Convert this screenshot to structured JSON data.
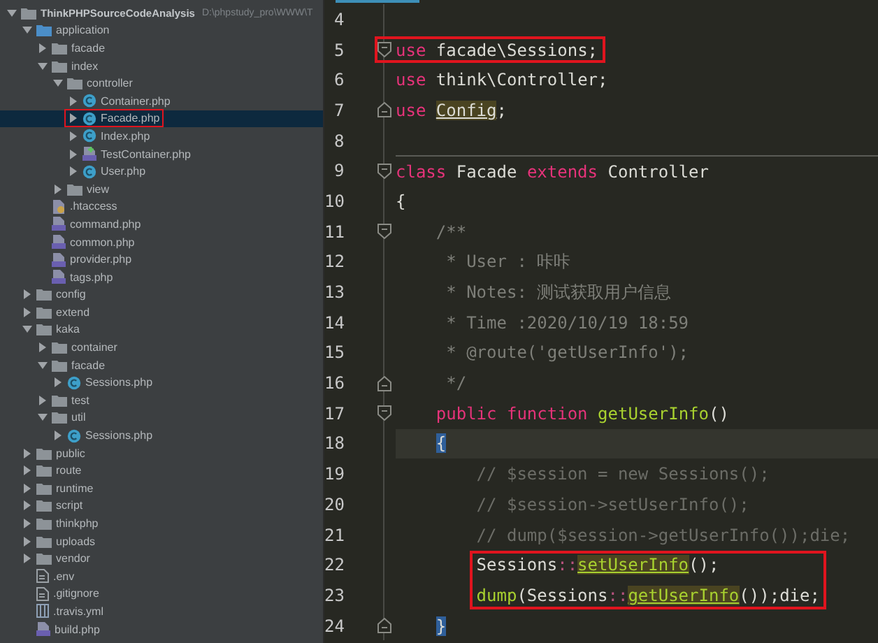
{
  "project_tree": {
    "label": "ThinkPHPSourceCodeAnalysis",
    "path": "D:\\phpstudy_pro\\WWW\\T",
    "kind": "folder",
    "expanded": true,
    "selected": false,
    "boxed": false,
    "children": [
      {
        "label": "application",
        "kind": "source",
        "expanded": true,
        "selected": false,
        "boxed": false,
        "children": [
          {
            "label": "facade",
            "kind": "folder",
            "expanded": false,
            "selected": false,
            "boxed": false
          },
          {
            "label": "index",
            "kind": "folder",
            "expanded": true,
            "selected": false,
            "boxed": false,
            "children": [
              {
                "label": "controller",
                "kind": "folder",
                "expanded": true,
                "selected": false,
                "boxed": false,
                "children": [
                  {
                    "label": "Container.php",
                    "kind": "class",
                    "expanded": false,
                    "selected": false,
                    "boxed": false
                  },
                  {
                    "label": "Facade.php",
                    "kind": "class",
                    "expanded": false,
                    "selected": true,
                    "boxed": true
                  },
                  {
                    "label": "Index.php",
                    "kind": "class",
                    "expanded": false,
                    "selected": false,
                    "boxed": false
                  },
                  {
                    "label": "TestContainer.php",
                    "kind": "test",
                    "expanded": false,
                    "selected": false,
                    "boxed": false
                  },
                  {
                    "label": "User.php",
                    "kind": "class",
                    "expanded": false,
                    "selected": false,
                    "boxed": false
                  }
                ]
              },
              {
                "label": "view",
                "kind": "folder",
                "expanded": false,
                "selected": false,
                "boxed": false
              }
            ]
          },
          {
            "label": ".htaccess",
            "kind": "config",
            "selected": false,
            "boxed": false
          },
          {
            "label": "command.php",
            "kind": "php",
            "selected": false,
            "boxed": false
          },
          {
            "label": "common.php",
            "kind": "php",
            "selected": false,
            "boxed": false
          },
          {
            "label": "provider.php",
            "kind": "php",
            "selected": false,
            "boxed": false
          },
          {
            "label": "tags.php",
            "kind": "php",
            "selected": false,
            "boxed": false
          }
        ]
      },
      {
        "label": "config",
        "kind": "folder",
        "expanded": false,
        "selected": false,
        "boxed": false
      },
      {
        "label": "extend",
        "kind": "folder",
        "expanded": false,
        "selected": false,
        "boxed": false
      },
      {
        "label": "kaka",
        "kind": "folder",
        "expanded": true,
        "selected": false,
        "boxed": false,
        "children": [
          {
            "label": "container",
            "kind": "folder",
            "expanded": false,
            "selected": false,
            "boxed": false
          },
          {
            "label": "facade",
            "kind": "folder",
            "expanded": true,
            "selected": false,
            "boxed": false,
            "children": [
              {
                "label": "Sessions.php",
                "kind": "class",
                "expanded": false,
                "selected": false,
                "boxed": false
              }
            ]
          },
          {
            "label": "test",
            "kind": "folder",
            "expanded": false,
            "selected": false,
            "boxed": false
          },
          {
            "label": "util",
            "kind": "folder",
            "expanded": true,
            "selected": false,
            "boxed": false,
            "children": [
              {
                "label": "Sessions.php",
                "kind": "class",
                "expanded": false,
                "selected": false,
                "boxed": false
              }
            ]
          }
        ]
      },
      {
        "label": "public",
        "kind": "folder",
        "expanded": false,
        "selected": false,
        "boxed": false
      },
      {
        "label": "route",
        "kind": "folder",
        "expanded": false,
        "selected": false,
        "boxed": false
      },
      {
        "label": "runtime",
        "kind": "folder",
        "expanded": false,
        "selected": false,
        "boxed": false
      },
      {
        "label": "script",
        "kind": "folder",
        "expanded": false,
        "selected": false,
        "boxed": false
      },
      {
        "label": "thinkphp",
        "kind": "folder",
        "expanded": false,
        "selected": false,
        "boxed": false
      },
      {
        "label": "uploads",
        "kind": "folder",
        "expanded": false,
        "selected": false,
        "boxed": false
      },
      {
        "label": "vendor",
        "kind": "folder",
        "expanded": false,
        "selected": false,
        "boxed": false
      },
      {
        "label": ".env",
        "kind": "text",
        "selected": false,
        "boxed": false
      },
      {
        "label": ".gitignore",
        "kind": "text",
        "selected": false,
        "boxed": false
      },
      {
        "label": ".travis.yml",
        "kind": "yml",
        "selected": false,
        "boxed": false
      },
      {
        "label": "build.php",
        "kind": "php",
        "selected": false,
        "boxed": false
      }
    ]
  },
  "code": {
    "lines": [
      {
        "number": "4",
        "fold_open": false,
        "fold_close": false,
        "current": false,
        "separator": false,
        "boxed": false
      },
      {
        "number": "5",
        "fold_open": true,
        "fold_close": false,
        "current": false,
        "separator": false,
        "boxed": true,
        "tokens": [
          {
            "kind": "keyword",
            "text": "use"
          },
          {
            "kind": "plain",
            "text": " facade\\Sessions;"
          }
        ]
      },
      {
        "number": "6",
        "fold_open": false,
        "fold_close": false,
        "current": false,
        "separator": false,
        "boxed": false,
        "tokens": [
          {
            "kind": "keyword",
            "text": "use"
          },
          {
            "kind": "plain",
            "text": " think\\Controller;"
          }
        ]
      },
      {
        "number": "7",
        "fold_open": false,
        "fold_close": true,
        "current": false,
        "separator": false,
        "boxed": false,
        "tokens": [
          {
            "kind": "keyword",
            "text": "use "
          },
          {
            "kind": "reference",
            "text": "Config"
          },
          {
            "kind": "plain",
            "text": ";"
          }
        ]
      },
      {
        "number": "8",
        "fold_open": false,
        "fold_close": false,
        "current": false,
        "separator": false,
        "boxed": false
      },
      {
        "number": "9",
        "fold_open": true,
        "fold_close": false,
        "current": false,
        "separator": true,
        "boxed": false,
        "tokens": [
          {
            "kind": "keyword",
            "text": "class"
          },
          {
            "kind": "plain",
            "text": " Facade "
          },
          {
            "kind": "keyword",
            "text": "extends"
          },
          {
            "kind": "plain",
            "text": " Controller"
          }
        ]
      },
      {
        "number": "10",
        "fold_open": false,
        "fold_close": false,
        "current": false,
        "separator": false,
        "boxed": false,
        "tokens": [
          {
            "kind": "plain",
            "text": "{"
          }
        ]
      },
      {
        "number": "11",
        "fold_open": true,
        "fold_close": false,
        "current": false,
        "separator": false,
        "boxed": false,
        "tokens": [
          {
            "kind": "doc",
            "text": "    /**"
          }
        ]
      },
      {
        "number": "12",
        "fold_open": false,
        "fold_close": false,
        "current": false,
        "separator": false,
        "boxed": false,
        "tokens": [
          {
            "kind": "doc",
            "text": "     * User : 咔咔"
          }
        ]
      },
      {
        "number": "13",
        "fold_open": false,
        "fold_close": false,
        "current": false,
        "separator": false,
        "boxed": false,
        "tokens": [
          {
            "kind": "doc",
            "text": "     * Notes: 测试获取用户信息"
          }
        ]
      },
      {
        "number": "14",
        "fold_open": false,
        "fold_close": false,
        "current": false,
        "separator": false,
        "boxed": false,
        "tokens": [
          {
            "kind": "doc",
            "text": "     * Time :2020/10/19 18:59"
          }
        ]
      },
      {
        "number": "15",
        "fold_open": false,
        "fold_close": false,
        "current": false,
        "separator": false,
        "boxed": false,
        "tokens": [
          {
            "kind": "doc",
            "text": "     * @route('getUserInfo');"
          }
        ]
      },
      {
        "number": "16",
        "fold_open": false,
        "fold_close": true,
        "current": false,
        "separator": false,
        "boxed": false,
        "tokens": [
          {
            "kind": "doc",
            "text": "     */"
          }
        ]
      },
      {
        "number": "17",
        "fold_open": true,
        "fold_close": false,
        "current": false,
        "separator": false,
        "boxed": false,
        "tokens": [
          {
            "kind": "keyword",
            "text": "    public function"
          },
          {
            "kind": "function",
            "text": " getUserInfo"
          },
          {
            "kind": "plain",
            "text": "()"
          }
        ]
      },
      {
        "number": "18",
        "fold_open": false,
        "fold_close": false,
        "current": true,
        "separator": false,
        "boxed": false,
        "tokens": [
          {
            "kind": "brace",
            "text": "    {"
          }
        ]
      },
      {
        "number": "19",
        "fold_open": false,
        "fold_close": false,
        "current": false,
        "separator": false,
        "boxed": false,
        "tokens": [
          {
            "kind": "comment",
            "text": "        // $session = new Sessions();"
          }
        ]
      },
      {
        "number": "20",
        "fold_open": false,
        "fold_close": false,
        "current": false,
        "separator": false,
        "boxed": false,
        "tokens": [
          {
            "kind": "comment",
            "text": "        // $session->setUserInfo();"
          }
        ]
      },
      {
        "number": "21",
        "fold_open": false,
        "fold_close": false,
        "current": false,
        "separator": false,
        "boxed": false,
        "tokens": [
          {
            "kind": "comment",
            "text": "        // dump($session->getUserInfo());die;"
          }
        ]
      },
      {
        "number": "22",
        "fold_open": false,
        "fold_close": false,
        "current": false,
        "separator": false,
        "boxed": true,
        "tokens": [
          {
            "kind": "plain",
            "text": "        Sessions"
          },
          {
            "kind": "operator",
            "text": "::"
          },
          {
            "kind": "call",
            "text": "setUserInfo"
          },
          {
            "kind": "plain",
            "text": "();"
          }
        ]
      },
      {
        "number": "23",
        "fold_open": false,
        "fold_close": false,
        "current": false,
        "separator": false,
        "boxed": true,
        "tokens": [
          {
            "kind": "function",
            "text": "        dump"
          },
          {
            "kind": "plain",
            "text": "(Sessions"
          },
          {
            "kind": "operator",
            "text": "::"
          },
          {
            "kind": "call",
            "text": "getUserInfo"
          },
          {
            "kind": "plain",
            "text": "());die;"
          }
        ]
      },
      {
        "number": "24",
        "fold_open": false,
        "fold_close": true,
        "current": false,
        "separator": false,
        "boxed": false,
        "tokens": [
          {
            "kind": "brace",
            "text": "    }"
          }
        ]
      }
    ]
  }
}
